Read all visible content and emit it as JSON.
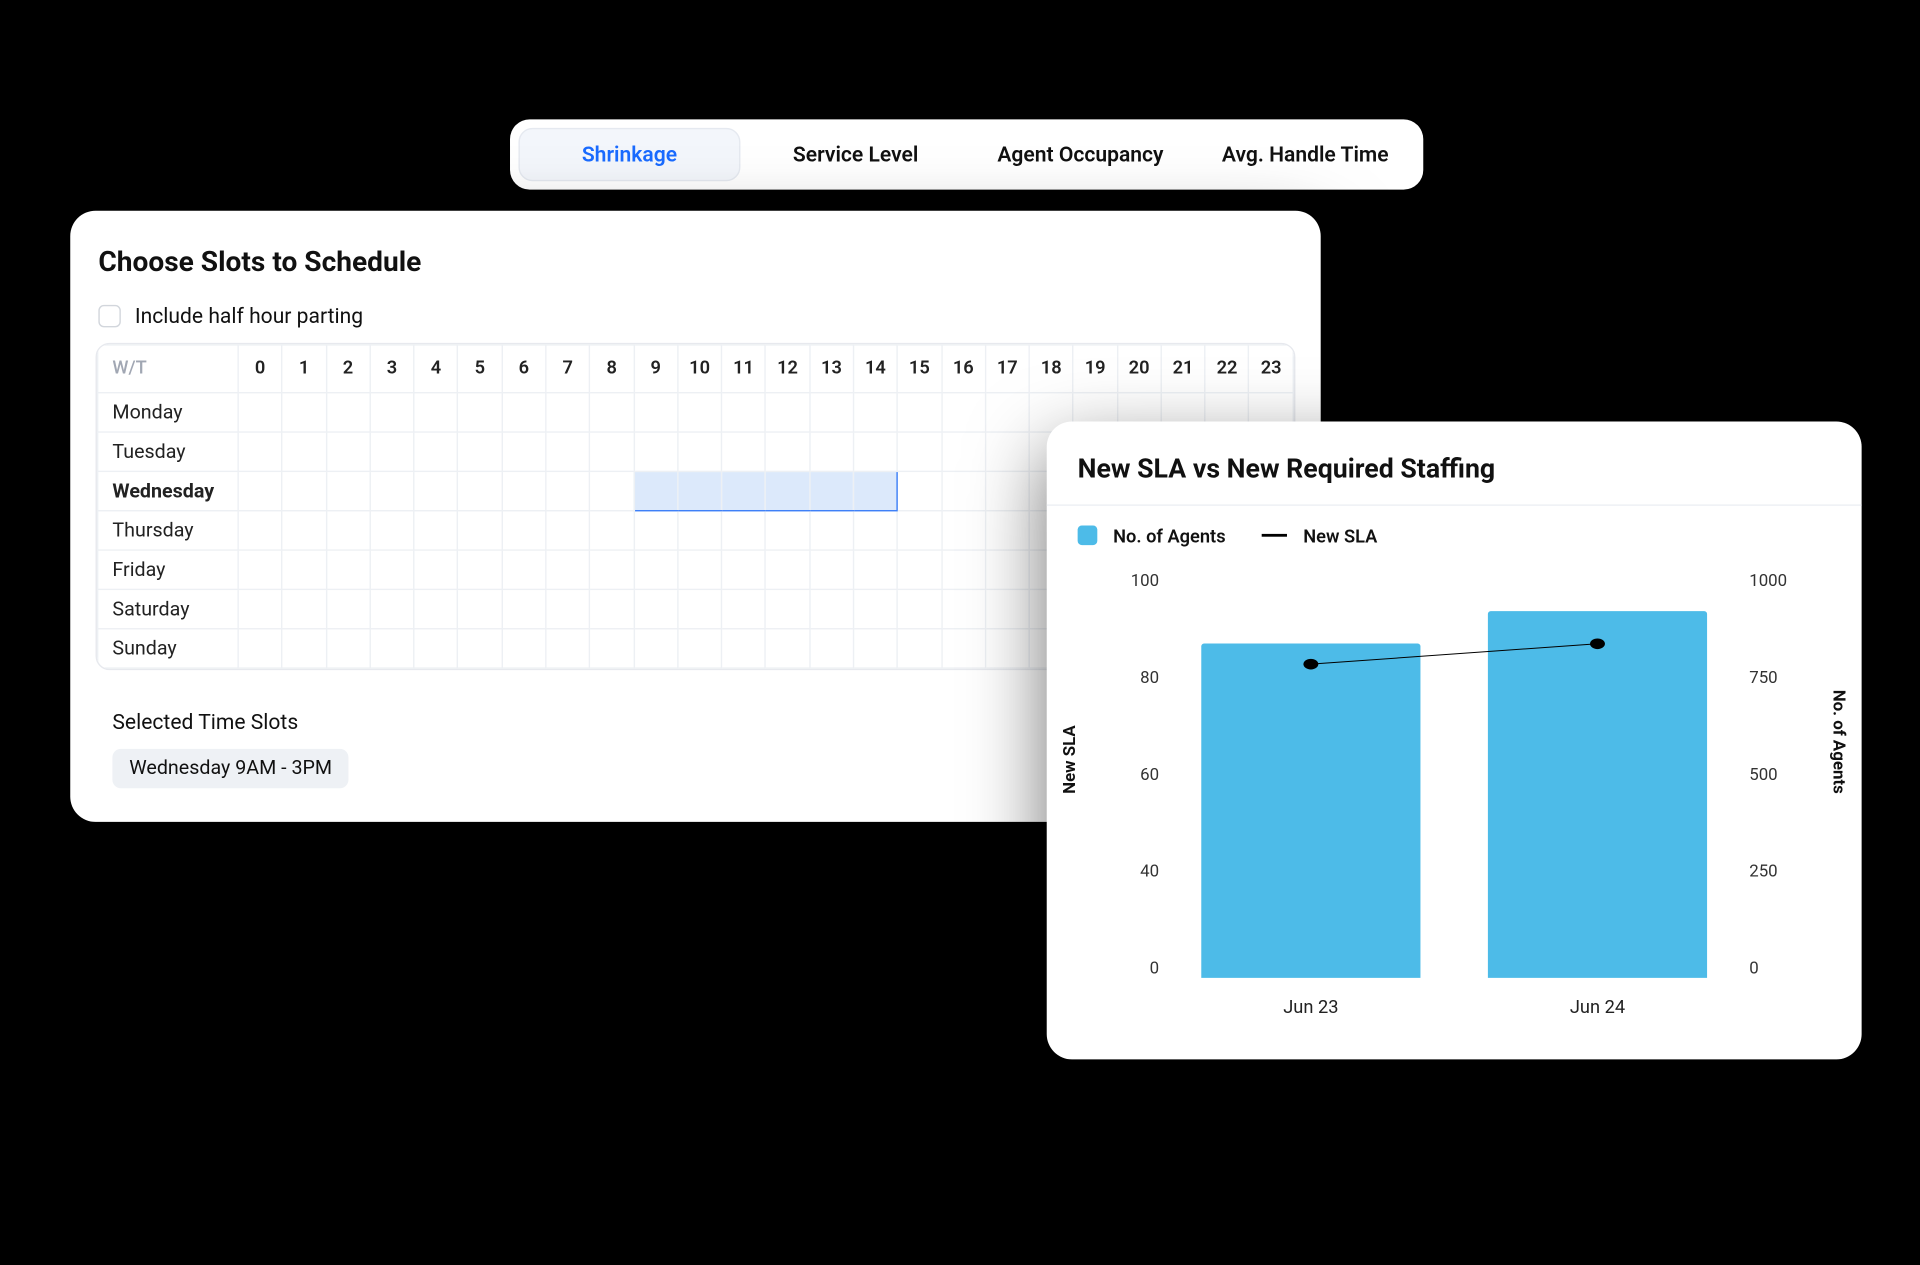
{
  "tabs": {
    "items": [
      "Shrinkage",
      "Service Level",
      "Agent Occupancy",
      "Avg. Handle Time"
    ],
    "active_index": 0
  },
  "schedule": {
    "title": "Choose Slots to Schedule",
    "half_hour_label": "Include half hour parting",
    "half_hour_checked": false,
    "wt_header": "W/T",
    "hours": [
      "0",
      "1",
      "2",
      "3",
      "4",
      "5",
      "6",
      "7",
      "8",
      "9",
      "10",
      "11",
      "12",
      "13",
      "14",
      "15",
      "16",
      "17",
      "18",
      "19",
      "20",
      "21",
      "22",
      "23"
    ],
    "days": [
      "Monday",
      "Tuesday",
      "Wednesday",
      "Thursday",
      "Friday",
      "Saturday",
      "Sunday"
    ],
    "selected": {
      "day_index": 2,
      "start_hour": 9,
      "end_hour_inclusive": 14
    },
    "selected_title": "Selected Time Slots",
    "selected_chip": "Wednesday 9AM - 3PM"
  },
  "chart": {
    "title": "New SLA vs New Required Staffing",
    "legend": {
      "bar_label": "No. of Agents",
      "line_label": "New SLA",
      "bar_color": "#4dbbe8"
    },
    "y_left_title": "New SLA",
    "y_right_title": "No. of Agents",
    "y_left_ticks": [
      "100",
      "80",
      "60",
      "40",
      "0"
    ],
    "y_right_ticks": [
      "1000",
      "750",
      "500",
      "250",
      "0"
    ]
  },
  "chart_data": {
    "type": "bar",
    "categories": [
      "Jun 23",
      "Jun 24"
    ],
    "series": [
      {
        "name": "No. of Agents",
        "axis": "right",
        "kind": "bar",
        "values": [
          820,
          900
        ]
      },
      {
        "name": "New SLA",
        "axis": "left",
        "kind": "line",
        "values": [
          77,
          82
        ]
      }
    ],
    "y_left": {
      "label": "New SLA",
      "range": [
        0,
        100
      ]
    },
    "y_right": {
      "label": "No. of Agents",
      "range": [
        0,
        1000
      ]
    }
  }
}
